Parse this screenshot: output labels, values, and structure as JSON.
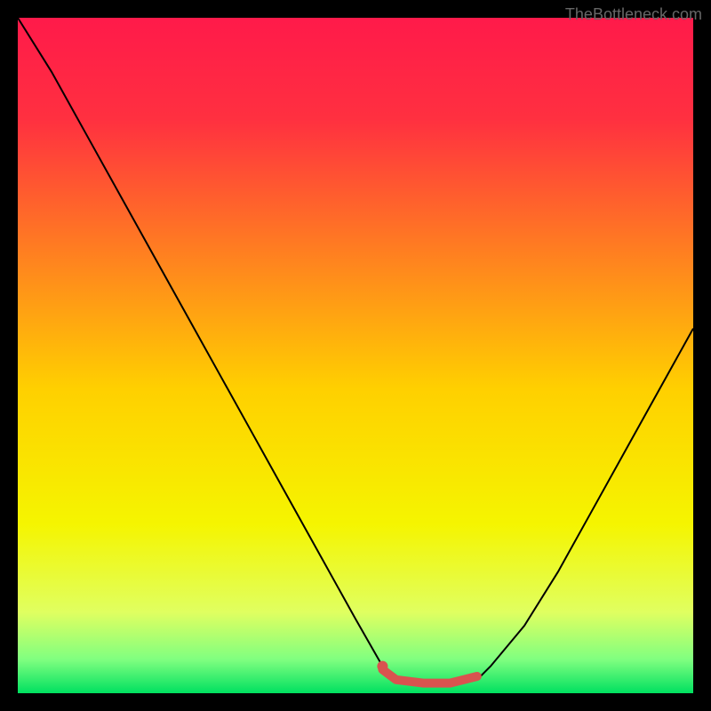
{
  "watermark": "TheBottleneck.com",
  "chart_data": {
    "type": "line",
    "title": "",
    "xlabel": "",
    "ylabel": "",
    "xlim": [
      0,
      100
    ],
    "ylim": [
      0,
      100
    ],
    "background_gradient": {
      "stops": [
        {
          "offset": 0,
          "color": "#ff1a4a"
        },
        {
          "offset": 15,
          "color": "#ff3040"
        },
        {
          "offset": 35,
          "color": "#ff8020"
        },
        {
          "offset": 55,
          "color": "#ffd000"
        },
        {
          "offset": 75,
          "color": "#f5f500"
        },
        {
          "offset": 88,
          "color": "#e0ff60"
        },
        {
          "offset": 95,
          "color": "#80ff80"
        },
        {
          "offset": 100,
          "color": "#00e060"
        }
      ]
    },
    "series": [
      {
        "name": "bottleneck-curve",
        "color": "#000000",
        "width": 2,
        "x": [
          0,
          5,
          10,
          15,
          20,
          25,
          30,
          35,
          40,
          45,
          50,
          54,
          56,
          60,
          64,
          68,
          70,
          75,
          80,
          85,
          90,
          95,
          100
        ],
        "y": [
          100,
          92,
          83,
          74,
          65,
          56,
          47,
          38,
          29,
          20,
          11,
          4,
          2,
          1,
          1,
          2,
          4,
          10,
          18,
          27,
          36,
          45,
          54
        ]
      },
      {
        "name": "optimal-marker",
        "color": "#d9534f",
        "width": 10,
        "cap": "round",
        "x": [
          54,
          56,
          60,
          64,
          68
        ],
        "y": [
          3.5,
          2,
          1.5,
          1.5,
          2.5
        ]
      },
      {
        "name": "optimal-dot",
        "type": "scatter",
        "color": "#d9534f",
        "radius": 6,
        "x": [
          54
        ],
        "y": [
          4
        ]
      }
    ]
  }
}
